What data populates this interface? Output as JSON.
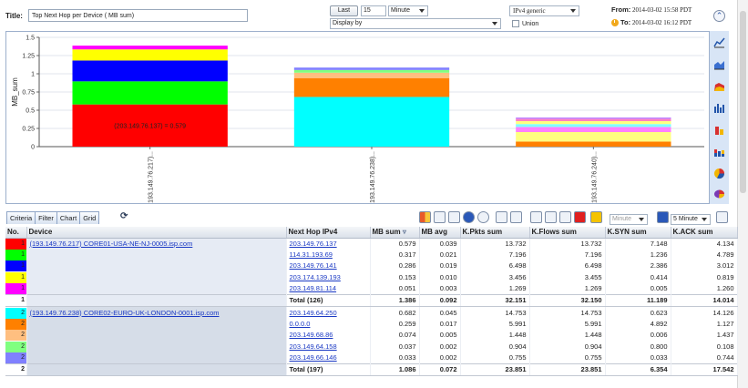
{
  "header": {
    "title_label": "Title:",
    "title_value": "Top Next Hop per Device ( MB sum)",
    "last_button": "Last",
    "last_value": "15",
    "unit": "Minute",
    "display_by": "Display by",
    "ipv4_select": "IPv4 generic",
    "union_label": "Union",
    "from_label": "From:",
    "from_value": "2014-03-02 15:58 PDT",
    "to_label": "To:",
    "to_value": "2014-03-02 16:12 PDT"
  },
  "chart_data": {
    "type": "bar",
    "stacked": true,
    "ylabel": "MB_sum",
    "ylim": [
      0,
      1.5
    ],
    "yticks": [
      "0",
      "0.25",
      "0.5",
      "0.75",
      "1",
      "1.25",
      "1.5"
    ],
    "categories": [
      "(193.149.76.217)...",
      "(193.149.76.238)...",
      "(193.149.76.240)..."
    ],
    "annotation": "(203.149.76.137) = 0.579",
    "stacks": [
      [
        {
          "value": 0.579,
          "color": "#ff0000"
        },
        {
          "value": 0.317,
          "color": "#00ff00"
        },
        {
          "value": 0.286,
          "color": "#0000ff"
        },
        {
          "value": 0.153,
          "color": "#ffff00"
        },
        {
          "value": 0.051,
          "color": "#ff00ff"
        }
      ],
      [
        {
          "value": 0.682,
          "color": "#00ffff"
        },
        {
          "value": 0.259,
          "color": "#ff8000"
        },
        {
          "value": 0.074,
          "color": "#ffbf80"
        },
        {
          "value": 0.037,
          "color": "#80ff80"
        },
        {
          "value": 0.033,
          "color": "#8080ff"
        }
      ],
      [
        {
          "value": 0.07,
          "color": "#ff8000"
        },
        {
          "value": 0.13,
          "color": "#ffff80"
        },
        {
          "value": 0.07,
          "color": "#ff80ff"
        },
        {
          "value": 0.04,
          "color": "#80ffff"
        },
        {
          "value": 0.04,
          "color": "#ffff80"
        },
        {
          "value": 0.03,
          "color": "#ff80c0"
        },
        {
          "value": 0.02,
          "color": "#c080ff"
        }
      ]
    ]
  },
  "tabs": [
    "Criteria",
    "Filter",
    "Chart",
    "Grid"
  ],
  "toolbar": {
    "minute_select": "Minute",
    "interval_select": "5 Minute"
  },
  "grid": {
    "columns": [
      "No.",
      "Device",
      "Next Hop IPv4",
      "MB sum",
      "MB avg",
      "K.Pkts sum",
      "K.Flows sum",
      "K.SYN sum",
      "K.ACK sum"
    ],
    "rows": [
      {
        "no": "1",
        "color": "#ff0000",
        "device": "(193.149.76.217) CORE01-USA-NE-NJ-0005.isp.com",
        "hop": "203.149.76.137",
        "mb_sum": "0.579",
        "mb_avg": "0.039",
        "pkts": "13.732",
        "flows": "13.732",
        "syn": "7.148",
        "ack": "4.134",
        "group": "g1",
        "total": false
      },
      {
        "no": "1",
        "color": "#00ff00",
        "device": "",
        "hop": "114.31.193.69",
        "mb_sum": "0.317",
        "mb_avg": "0.021",
        "pkts": "7.196",
        "flows": "7.196",
        "syn": "1.236",
        "ack": "4.789",
        "group": "g1",
        "total": false
      },
      {
        "no": "1",
        "color": "#0000ff",
        "device": "",
        "hop": "203.149.76.141",
        "mb_sum": "0.286",
        "mb_avg": "0.019",
        "pkts": "6.498",
        "flows": "6.498",
        "syn": "2.386",
        "ack": "3.012",
        "group": "g1",
        "total": false
      },
      {
        "no": "1",
        "color": "#ffff00",
        "device": "",
        "hop": "203.174.139.193",
        "mb_sum": "0.153",
        "mb_avg": "0.010",
        "pkts": "3.456",
        "flows": "3.455",
        "syn": "0.414",
        "ack": "0.819",
        "group": "g1",
        "total": false
      },
      {
        "no": "1",
        "color": "#ff00ff",
        "device": "",
        "hop": "203.149.81.114",
        "mb_sum": "0.051",
        "mb_avg": "0.003",
        "pkts": "1.269",
        "flows": "1.269",
        "syn": "0.005",
        "ack": "1.260",
        "group": "g1",
        "total": false
      },
      {
        "no": "1",
        "color": "#ffffff",
        "device": "",
        "hop": "Total (126)",
        "mb_sum": "1.386",
        "mb_avg": "0.092",
        "pkts": "32.151",
        "flows": "32.150",
        "syn": "11.189",
        "ack": "14.014",
        "group": "g1",
        "total": true
      },
      {
        "no": "2",
        "color": "#00ffff",
        "device": "(193.149.76.238) CORE02-EURO-UK-LONDON-0001.isp.com",
        "hop": "203.149.64.250",
        "mb_sum": "0.682",
        "mb_avg": "0.045",
        "pkts": "14.753",
        "flows": "14.753",
        "syn": "0.623",
        "ack": "14.126",
        "group": "g2",
        "total": false
      },
      {
        "no": "2",
        "color": "#ff8000",
        "device": "",
        "hop": "0.0.0.0",
        "mb_sum": "0.259",
        "mb_avg": "0.017",
        "pkts": "5.991",
        "flows": "5.991",
        "syn": "4.892",
        "ack": "1.127",
        "group": "g2",
        "total": false
      },
      {
        "no": "2",
        "color": "#ffbf80",
        "device": "",
        "hop": "203.149.68.86",
        "mb_sum": "0.074",
        "mb_avg": "0.005",
        "pkts": "1.448",
        "flows": "1.448",
        "syn": "0.006",
        "ack": "1.437",
        "group": "g2",
        "total": false
      },
      {
        "no": "2",
        "color": "#80ff80",
        "device": "",
        "hop": "203.149.64.158",
        "mb_sum": "0.037",
        "mb_avg": "0.002",
        "pkts": "0.904",
        "flows": "0.904",
        "syn": "0.800",
        "ack": "0.108",
        "group": "g2",
        "total": false
      },
      {
        "no": "2",
        "color": "#8080ff",
        "device": "",
        "hop": "203.149.66.146",
        "mb_sum": "0.033",
        "mb_avg": "0.002",
        "pkts": "0.755",
        "flows": "0.755",
        "syn": "0.033",
        "ack": "0.744",
        "group": "g2",
        "total": false
      },
      {
        "no": "2",
        "color": "#ffffff",
        "device": "",
        "hop": "Total (197)",
        "mb_sum": "1.086",
        "mb_avg": "0.072",
        "pkts": "23.851",
        "flows": "23.851",
        "syn": "6.354",
        "ack": "17.542",
        "group": "g2",
        "total": true
      }
    ]
  },
  "colors": {
    "panel_border": "#9db0cc",
    "toolstrip_bg": "#d8e5f6",
    "link": "#1a39c4"
  }
}
